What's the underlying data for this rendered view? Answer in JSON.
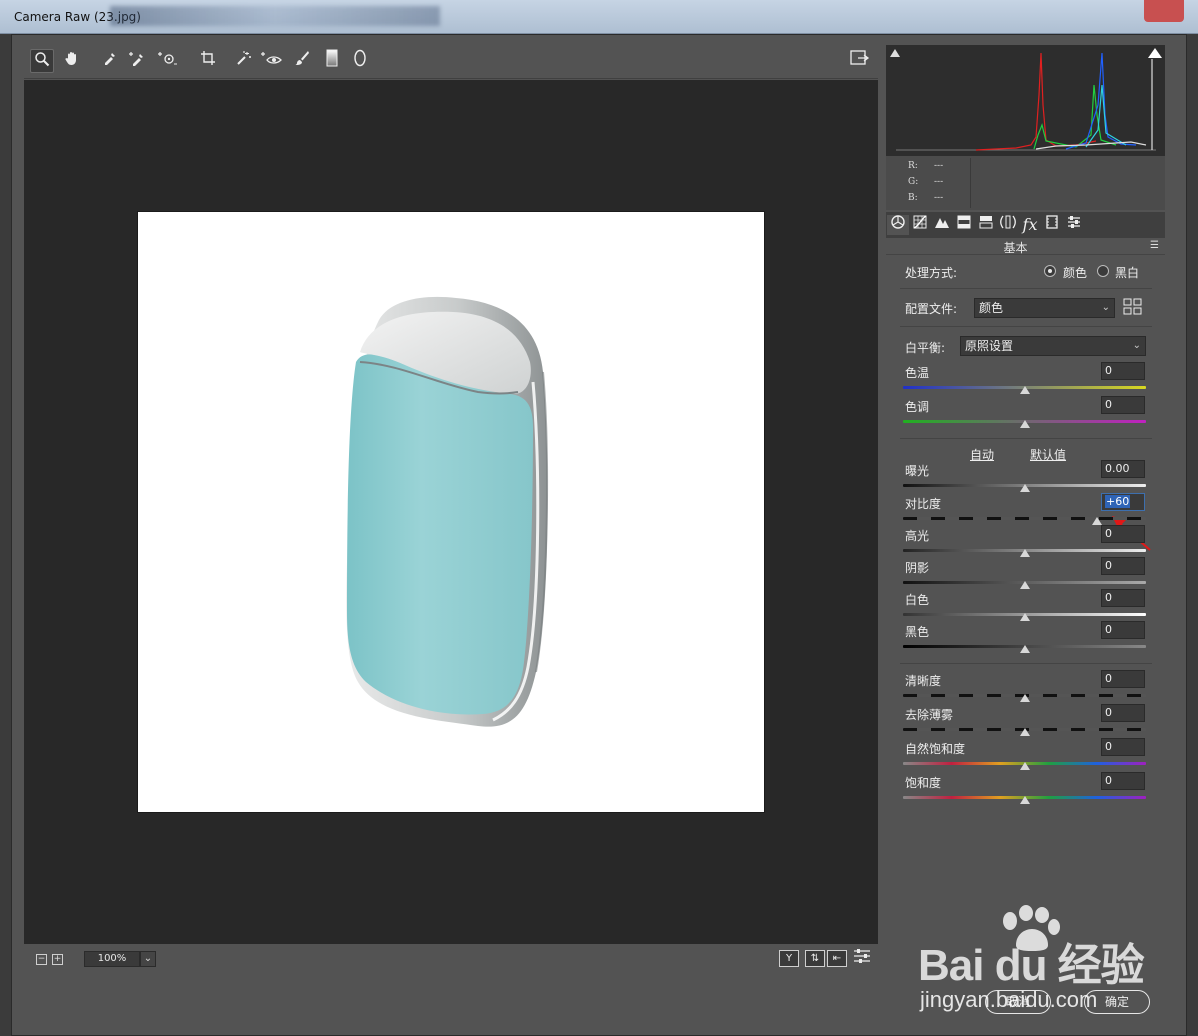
{
  "window": {
    "title": "Camera Raw (23.jpg)"
  },
  "toolbar": {
    "tools": [
      "zoom-icon",
      "hand-icon",
      "white-balance-icon",
      "color-sampler-icon",
      "targeted-adjust-icon",
      "crop-icon",
      "spot-removal-icon",
      "red-eye-icon",
      "adjustment-brush-icon",
      "graduated-filter-icon",
      "radial-filter-icon"
    ],
    "open_prefs_icon": "preferences-icon"
  },
  "status": {
    "zoom": "100%"
  },
  "histogram": {
    "r_label": "R:",
    "g_label": "G:",
    "b_label": "B:",
    "r_value": "---",
    "g_value": "---",
    "b_value": "---"
  },
  "panel": {
    "title": "基本",
    "tabs": [
      "basic-icon",
      "tone-curve-icon",
      "detail-icon",
      "hsl-icon",
      "split-tone-icon",
      "lens-icon",
      "effects-icon",
      "calibration-icon",
      "presets-icon"
    ],
    "treatment": {
      "label": "处理方式:",
      "color": "颜色",
      "bw": "黑白",
      "selected": "颜色"
    },
    "profile": {
      "label": "配置文件:",
      "value": "颜色"
    },
    "white_balance": {
      "label": "白平衡:",
      "value": "原照设置"
    },
    "auto": "自动",
    "defaults": "默认值",
    "sliders": [
      {
        "label": "色温",
        "value": "0",
        "level": 0
      },
      {
        "label": "色调",
        "value": "0",
        "level": 0
      },
      {
        "label": "曝光",
        "value": "0.00",
        "level": 0
      },
      {
        "label": "对比度",
        "value": "+60",
        "level": 60
      },
      {
        "label": "高光",
        "value": "0",
        "level": 0
      },
      {
        "label": "阴影",
        "value": "0",
        "level": 0
      },
      {
        "label": "白色",
        "value": "0",
        "level": 0
      },
      {
        "label": "黑色",
        "value": "0",
        "level": 0
      },
      {
        "label": "清晰度",
        "value": "0",
        "level": 0
      },
      {
        "label": "去除薄雾",
        "value": "0",
        "level": 0
      },
      {
        "label": "自然饱和度",
        "value": "0",
        "level": 0
      },
      {
        "label": "饱和度",
        "value": "0",
        "level": 0
      }
    ]
  },
  "buttons": {
    "cancel": "取消",
    "ok": "确定"
  },
  "watermark": {
    "brand": "Bai du 经验",
    "url": "jingyan.baidu.com"
  }
}
